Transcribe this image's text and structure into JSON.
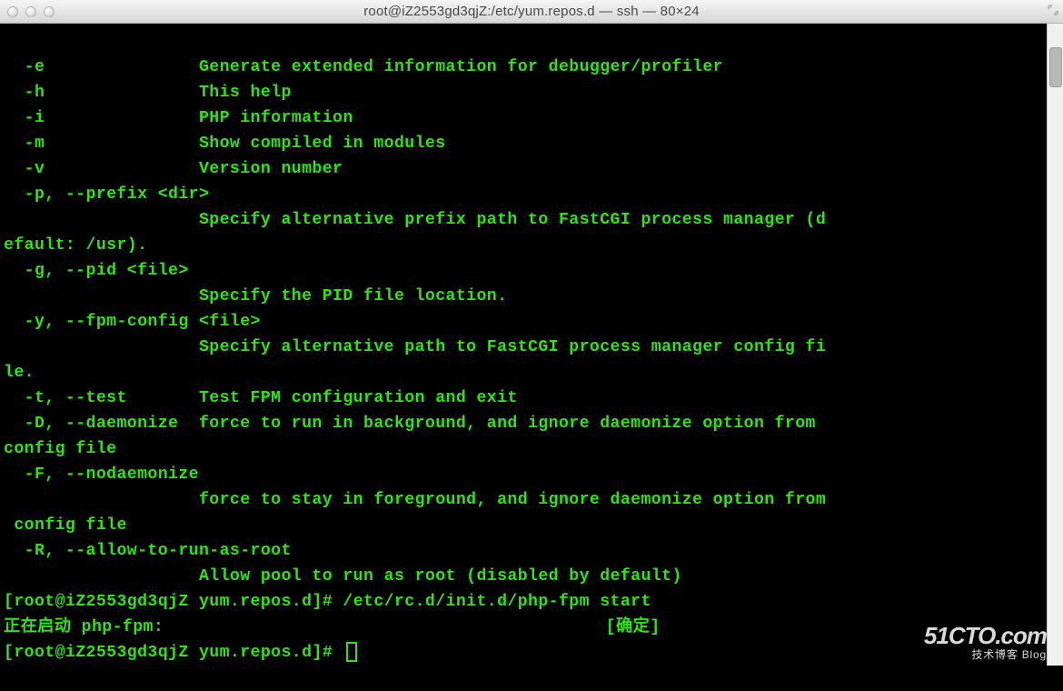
{
  "titlebar": {
    "title": "root@iZ2553gd3qjZ:/etc/yum.repos.d — ssh — 80×24"
  },
  "terminal_lines": [
    "  -e               Generate extended information for debugger/profiler",
    "  -h               This help",
    "  -i               PHP information",
    "  -m               Show compiled in modules",
    "  -v               Version number",
    "  -p, --prefix <dir>",
    "                   Specify alternative prefix path to FastCGI process manager (d",
    "efault: /usr).",
    "  -g, --pid <file>",
    "                   Specify the PID file location.",
    "  -y, --fpm-config <file>",
    "                   Specify alternative path to FastCGI process manager config fi",
    "le.",
    "  -t, --test       Test FPM configuration and exit",
    "  -D, --daemonize  force to run in background, and ignore daemonize option from ",
    "config file",
    "  -F, --nodaemonize",
    "                   force to stay in foreground, and ignore daemonize option from",
    " config file",
    "  -R, --allow-to-run-as-root",
    "                   Allow pool to run as root (disabled by default)"
  ],
  "prompt1": {
    "prefix": "[root@iZ2553gd3qjZ yum.repos.d]# ",
    "command": "/etc/rc.d/init.d/php-fpm start"
  },
  "status_line": {
    "left": "正在启动 php-fpm:",
    "right": "[确定]"
  },
  "prompt2": {
    "prefix": "[root@iZ2553gd3qjZ yum.repos.d]# "
  },
  "watermark": {
    "logo": "51CTO.com",
    "sub": "技术博客  Blog"
  }
}
